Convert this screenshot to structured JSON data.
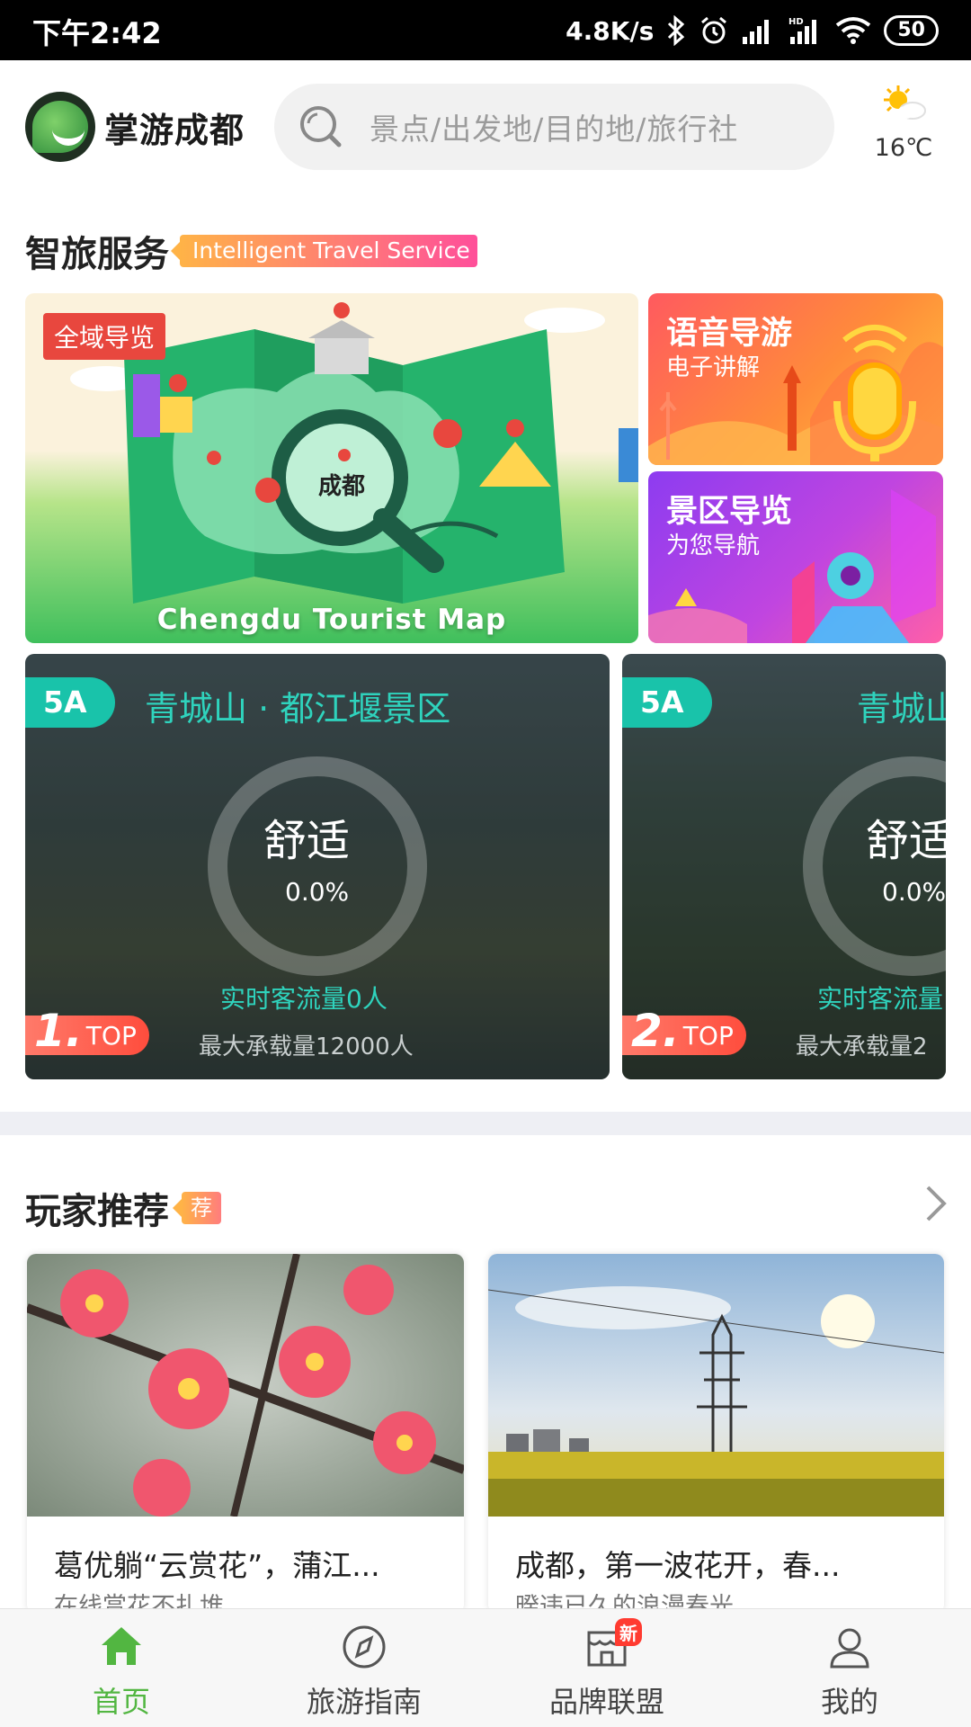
{
  "status_bar": {
    "time": "下午2:42",
    "network_speed": "4.8K/s",
    "battery": "50",
    "icons": [
      "bluetooth-icon",
      "alarm-icon",
      "signal-icon",
      "hd-signal-icon",
      "wifi-icon",
      "battery-icon"
    ]
  },
  "header": {
    "app_name": "掌游成都",
    "search_placeholder": "景点/出发地/目的地/旅行社",
    "weather": {
      "icon": "partly-sunny-icon",
      "temperature": "16℃"
    }
  },
  "smart_service": {
    "title": "智旅服务",
    "subtitle_en": "Intelligent Travel Service",
    "map_card": {
      "badge": "全域导览",
      "center_label": "成都",
      "caption": "Chengdu Tourist Map"
    },
    "audio_guide": {
      "title": "语音导游",
      "subtitle": "电子讲解"
    },
    "scenic_guide": {
      "title": "景区导览",
      "subtitle": "为您导航"
    }
  },
  "spots": [
    {
      "level": "5A",
      "name": "青城山 · 都江堰景区",
      "comfort": "舒适",
      "percentage": "0.0%",
      "flow": "实时客流量0人",
      "max_capacity": "最大承载量12000人",
      "rank": "1.",
      "rank_label": "TOP"
    },
    {
      "level": "5A",
      "name": "青城山",
      "comfort": "舒适",
      "percentage": "0.0%",
      "flow": "实时客流量",
      "max_capacity": "最大承载量2",
      "rank": "2.",
      "rank_label": "TOP"
    }
  ],
  "recommend": {
    "title": "玩家推荐",
    "tag": "荐",
    "items": [
      {
        "title": "葛优躺“云赏花”，蒲江...",
        "subtitle": "在线赏花不扎堆"
      },
      {
        "title": "成都，第一波花开，春...",
        "subtitle": "暌违已久的浪漫春光"
      }
    ]
  },
  "bottom_nav": {
    "items": [
      {
        "label": "首页",
        "icon": "home-icon",
        "active": true
      },
      {
        "label": "旅游指南",
        "icon": "compass-icon",
        "active": false
      },
      {
        "label": "品牌联盟",
        "icon": "store-icon",
        "active": false,
        "badge": "新"
      },
      {
        "label": "我的",
        "icon": "user-icon",
        "active": false
      }
    ]
  },
  "colors": {
    "brand_green": "#52b641",
    "teal": "#19c3aa",
    "badge_red": "#e8473e"
  }
}
